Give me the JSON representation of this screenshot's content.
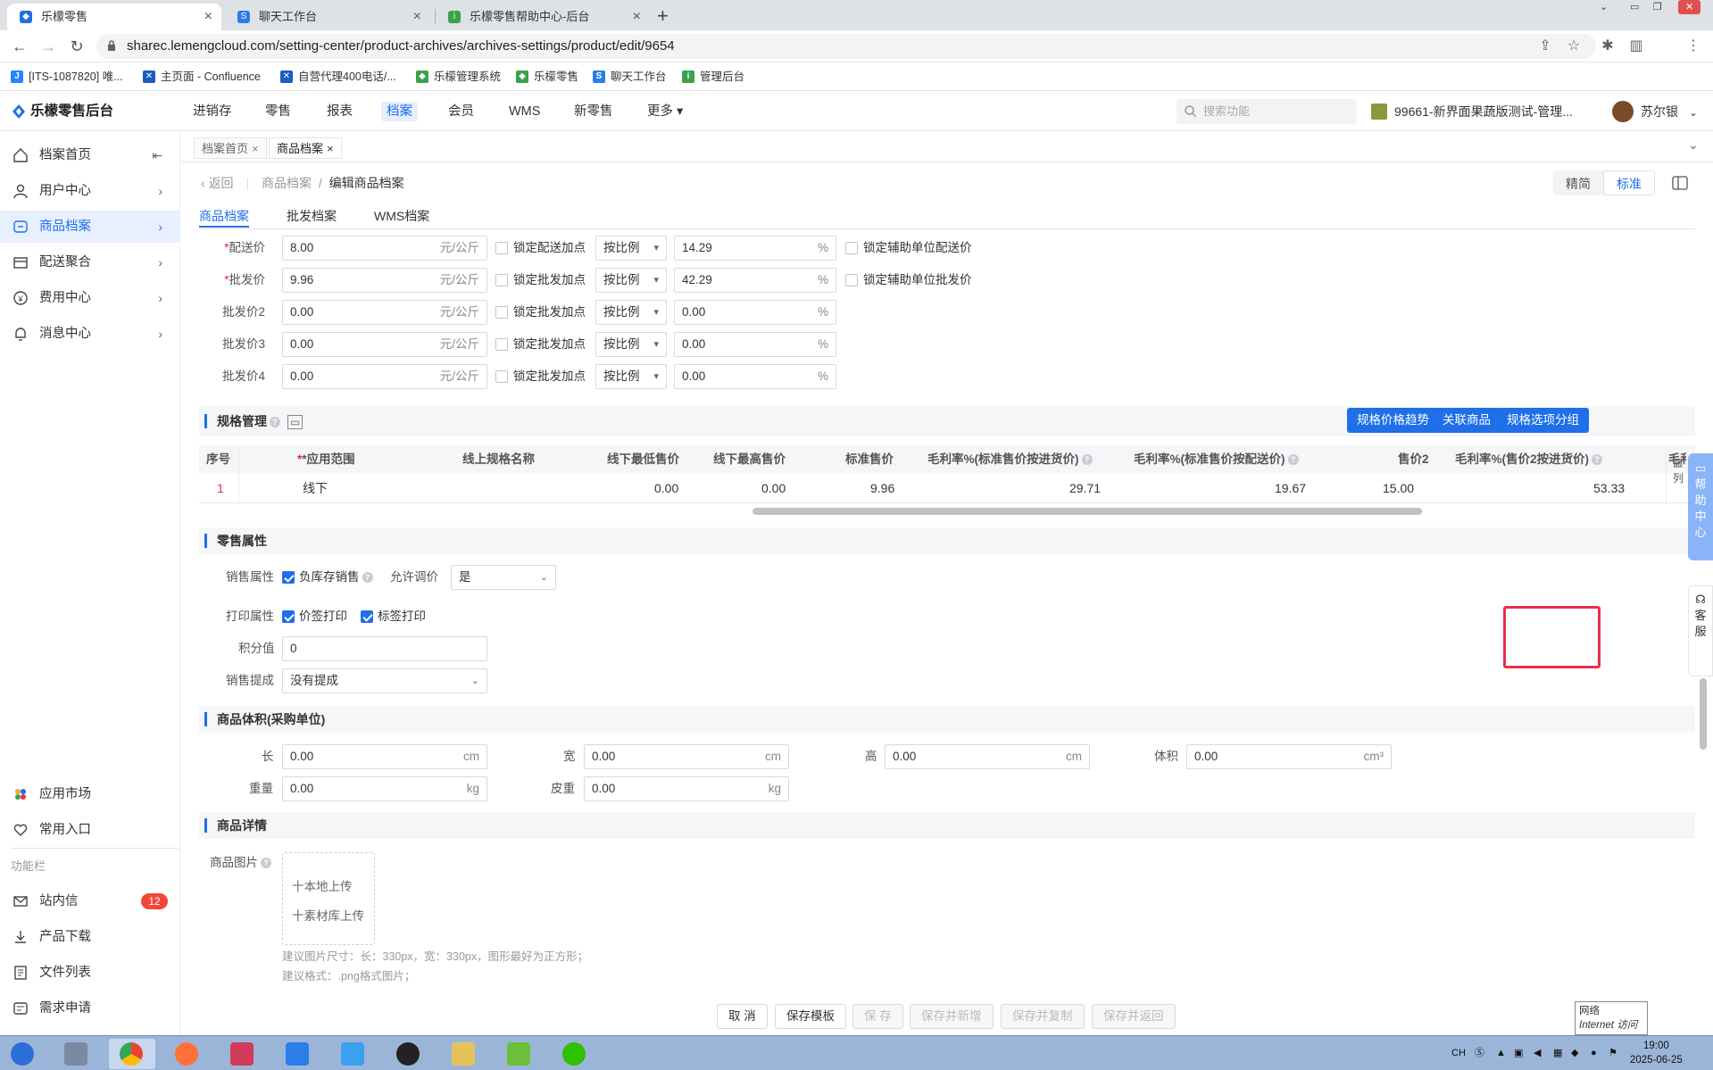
{
  "browser": {
    "tabs": [
      {
        "title": "乐檬零售"
      },
      {
        "title": "聊天工作台"
      },
      {
        "title": "乐檬零售帮助中心-后台"
      }
    ],
    "url": "sharec.lemengcloud.com/setting-center/product-archives/archives-settings/product/edit/9654",
    "bookmarks": [
      {
        "label": "[ITS-1087820] 唯..."
      },
      {
        "label": "主页面 - Confluence"
      },
      {
        "label": "自营代理400电话/..."
      },
      {
        "label": "乐檬管理系统"
      },
      {
        "label": "乐檬零售"
      },
      {
        "label": "聊天工作台"
      },
      {
        "label": "管理后台"
      }
    ]
  },
  "app": {
    "logo": "乐檬零售后台",
    "nav": [
      "进销存",
      "零售",
      "报表",
      "档案",
      "会员",
      "WMS",
      "新零售",
      "更多"
    ],
    "active_nav": "档案",
    "search_placeholder": "搜索功能",
    "store": "99661-新界面果蔬版测试-管理...",
    "user": "苏尔银"
  },
  "sidebar": {
    "items": [
      {
        "label": "档案首页",
        "icon": "home-icon"
      },
      {
        "label": "用户中心",
        "icon": "user-icon"
      },
      {
        "label": "商品档案",
        "icon": "product-icon"
      },
      {
        "label": "配送聚合",
        "icon": "delivery-icon"
      },
      {
        "label": "费用中心",
        "icon": "fee-icon"
      },
      {
        "label": "消息中心",
        "icon": "bell-icon"
      }
    ],
    "bottom": [
      {
        "label": "应用市场"
      },
      {
        "label": "常用入口"
      }
    ],
    "section_label": "功能栏",
    "tools": [
      {
        "label": "站内信",
        "badge": "12"
      },
      {
        "label": "产品下载"
      },
      {
        "label": "文件列表"
      },
      {
        "label": "需求申请"
      }
    ]
  },
  "page_tabs": [
    "档案首页",
    "商品档案"
  ],
  "breadcrumb": {
    "back": "返回",
    "parent": "商品档案",
    "current": "编辑商品档案"
  },
  "view_toggle": [
    "精简",
    "标准"
  ],
  "sub_tabs": [
    "商品档案",
    "批发档案",
    "WMS档案"
  ],
  "price_rows": [
    {
      "label": "配送价",
      "required": true,
      "value": "8.00",
      "unit": "元/公斤",
      "lock_label": "锁定配送加点",
      "mode": "按比例",
      "pct": "14.29",
      "aux_label": "锁定辅助单位配送价"
    },
    {
      "label": "批发价",
      "required": true,
      "value": "9.96",
      "unit": "元/公斤",
      "lock_label": "锁定批发加点",
      "mode": "按比例",
      "pct": "42.29",
      "aux_label": "锁定辅助单位批发价"
    },
    {
      "label": "批发价2",
      "required": false,
      "value": "0.00",
      "unit": "元/公斤",
      "lock_label": "锁定批发加点",
      "mode": "按比例",
      "pct": "0.00",
      "aux_label": ""
    },
    {
      "label": "批发价3",
      "required": false,
      "value": "0.00",
      "unit": "元/公斤",
      "lock_label": "锁定批发加点",
      "mode": "按比例",
      "pct": "0.00",
      "aux_label": ""
    },
    {
      "label": "批发价4",
      "required": false,
      "value": "0.00",
      "unit": "元/公斤",
      "lock_label": "锁定批发加点",
      "mode": "按比例",
      "pct": "0.00",
      "aux_label": ""
    }
  ],
  "pct_symbol": "%",
  "spec": {
    "title": "规格管理",
    "buttons": [
      "规格价格趋势",
      "关联商品",
      "规格选项分组"
    ],
    "columns": [
      "序号",
      "*应用范围",
      "线上规格名称",
      "线下最低售价",
      "线下最高售价",
      "标准售价",
      "毛利率%(标准售价按进货价)",
      "毛利率%(标准售价按配送价)",
      "售价2",
      "毛利率%(售价2按进货价)",
      "毛利"
    ],
    "row": [
      "1",
      "线下",
      "",
      "0.00",
      "0.00",
      "9.96",
      "29.71",
      "19.67",
      "15.00",
      "53.33",
      ""
    ],
    "col_setting": "列"
  },
  "retail": {
    "title": "零售属性",
    "sale_attr_label": "销售属性",
    "neg_stock_label": "负库存销售",
    "allow_adjust_label": "允许调价",
    "allow_adjust_value": "是",
    "print_attr_label": "打印属性",
    "price_print_label": "价签打印",
    "label_print_label": "标签打印",
    "points_label": "积分值",
    "points_value": "0",
    "commission_label": "销售提成",
    "commission_value": "没有提成"
  },
  "volume": {
    "title": "商品体积(采购单位)",
    "length_label": "长",
    "length": "0.00",
    "length_unit": "cm",
    "width_label": "宽",
    "width": "0.00",
    "width_unit": "cm",
    "height_label": "高",
    "height": "0.00",
    "height_unit": "cm",
    "vol_label": "体积",
    "vol": "0.00",
    "vol_unit": "cm³",
    "weight_label": "重量",
    "weight": "0.00",
    "weight_unit": "kg",
    "tare_label": "皮重",
    "tare": "0.00",
    "tare_unit": "kg"
  },
  "detail": {
    "title": "商品详情",
    "image_label": "商品图片",
    "upload_local": "十本地上传",
    "upload_lib": "十素材库上传",
    "hint1": "建议图片尺寸：长：330px，宽：330px，图形最好为正方形；",
    "hint2": "建议格式：.png格式图片；"
  },
  "footer": {
    "buttons": [
      "取 消",
      "保存模板",
      "保 存",
      "保存并新增",
      "保存并复制",
      "保存并返回"
    ]
  },
  "float": {
    "help": "帮助中心",
    "service": "客服"
  },
  "net_tip": {
    "line1": "网络",
    "line2": "Internet 访问"
  },
  "taskbar": {
    "ime": "CH",
    "time": "19:00",
    "date": "2025-06-25"
  }
}
